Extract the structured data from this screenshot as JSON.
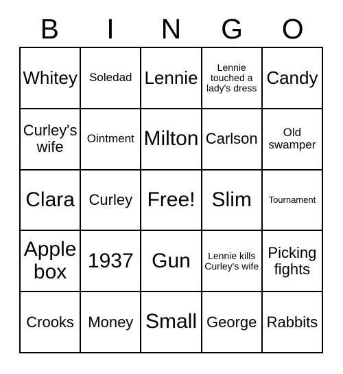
{
  "card": {
    "headers": [
      "B",
      "I",
      "N",
      "G",
      "O"
    ],
    "rows": [
      [
        {
          "text": "Whitey",
          "size": "fs-lg"
        },
        {
          "text": "Soledad",
          "size": "fs-sm"
        },
        {
          "text": "Lennie",
          "size": "fs-lg"
        },
        {
          "text": "Lennie touched a lady's dress",
          "size": "fs-xs"
        },
        {
          "text": "Candy",
          "size": "fs-lg"
        }
      ],
      [
        {
          "text": "Curley's wife",
          "size": "fs-md"
        },
        {
          "text": "Ointment",
          "size": "fs-sm"
        },
        {
          "text": "Milton",
          "size": "fs-xl"
        },
        {
          "text": "Carlson",
          "size": "fs-md"
        },
        {
          "text": "Old swamper",
          "size": "fs-sm"
        }
      ],
      [
        {
          "text": "Clara",
          "size": "fs-xl"
        },
        {
          "text": "Curley",
          "size": "fs-md"
        },
        {
          "text": "Free!",
          "size": "fs-xl"
        },
        {
          "text": "Slim",
          "size": "fs-xl"
        },
        {
          "text": "Tournament",
          "size": "fs-xxs"
        }
      ],
      [
        {
          "text": "Apple box",
          "size": "fs-xl"
        },
        {
          "text": "1937",
          "size": "fs-xl"
        },
        {
          "text": "Gun",
          "size": "fs-xl"
        },
        {
          "text": "Lennie kills Curley's wife",
          "size": "fs-xs"
        },
        {
          "text": "Picking fights",
          "size": "fs-md"
        }
      ],
      [
        {
          "text": "Crooks",
          "size": "fs-md"
        },
        {
          "text": "Money",
          "size": "fs-md"
        },
        {
          "text": "Small",
          "size": "fs-xl"
        },
        {
          "text": "George",
          "size": "fs-md"
        },
        {
          "text": "Rabbits",
          "size": "fs-md"
        }
      ]
    ]
  },
  "colors": {
    "border": "#000000",
    "text": "#000000",
    "background": "#ffffff"
  }
}
